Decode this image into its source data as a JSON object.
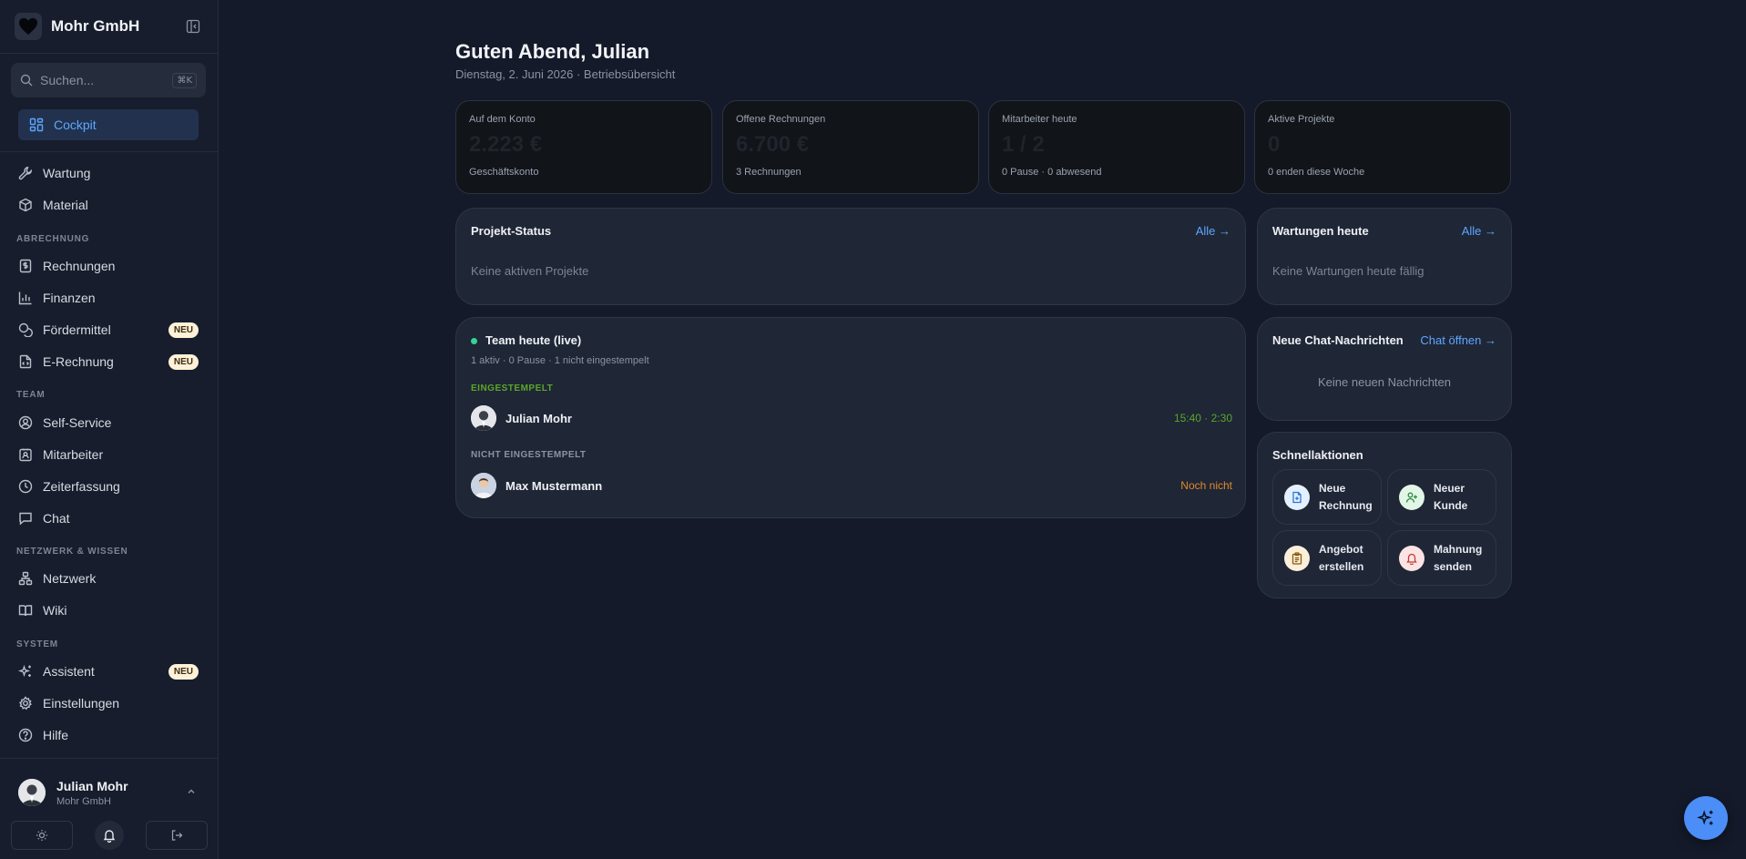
{
  "brand": {
    "name": "Mohr GmbH",
    "logo_icon": "heart-icon"
  },
  "search": {
    "placeholder": "Suchen...",
    "shortcut": "⌘K"
  },
  "sidebar": {
    "active": {
      "label": "Cockpit",
      "icon": "dashboard-icon"
    },
    "items": [
      {
        "label": "Wartung",
        "icon": "wrench-icon"
      },
      {
        "label": "Material",
        "icon": "box-icon"
      }
    ],
    "sections": [
      {
        "title": "ABRECHNUNG",
        "items": [
          {
            "label": "Rechnungen",
            "icon": "invoice-icon"
          },
          {
            "label": "Finanzen",
            "icon": "chart-icon"
          },
          {
            "label": "Fördermittel",
            "icon": "coins-icon",
            "badge": "NEU"
          },
          {
            "label": "E-Rechnung",
            "icon": "e-invoice-icon",
            "badge": "NEU"
          }
        ]
      },
      {
        "title": "TEAM",
        "items": [
          {
            "label": "Self-Service",
            "icon": "user-circle-icon"
          },
          {
            "label": "Mitarbeiter",
            "icon": "id-badge-icon"
          },
          {
            "label": "Zeiterfassung",
            "icon": "clock-icon"
          },
          {
            "label": "Chat",
            "icon": "chat-icon"
          }
        ]
      },
      {
        "title": "NETZWERK & WISSEN",
        "items": [
          {
            "label": "Netzwerk",
            "icon": "network-icon"
          },
          {
            "label": "Wiki",
            "icon": "book-icon"
          }
        ]
      },
      {
        "title": "SYSTEM",
        "items": [
          {
            "label": "Assistent",
            "icon": "sparkles-icon",
            "badge": "NEU"
          },
          {
            "label": "Einstellungen",
            "icon": "gear-icon"
          },
          {
            "label": "Hilfe",
            "icon": "help-icon"
          }
        ]
      }
    ]
  },
  "user": {
    "name": "Julian Mohr",
    "company": "Mohr GmbH"
  },
  "header": {
    "greeting": "Guten Abend, Julian",
    "subline": "Dienstag, 2. Juni 2026 · Betriebsübersicht"
  },
  "stats": [
    {
      "label": "Auf dem Konto",
      "value": "2.223 €",
      "sub": "Geschäftskonto"
    },
    {
      "label": "Offene Rechnungen",
      "value": "6.700 €",
      "sub": "3 Rechnungen"
    },
    {
      "label": "Mitarbeiter heute",
      "value": "1 / 2",
      "sub": "0 Pause · 0 abwesend"
    },
    {
      "label": "Aktive Projekte",
      "value": "0",
      "sub": "0 enden diese Woche"
    }
  ],
  "projects": {
    "title": "Projekt-Status",
    "link": "Alle →",
    "empty": "Keine aktiven Projekte"
  },
  "maintenance": {
    "title": "Wartungen heute",
    "link": "Alle →",
    "empty": "Keine Wartungen heute fällig"
  },
  "team": {
    "title": "Team heute (live)",
    "summary": "1 aktiv · 0 Pause · 1 nicht eingestempelt",
    "clocked_in_label": "EINGESTEMPELT",
    "not_clocked_label": "NICHT EINGESTEMPELT",
    "clocked_in": [
      {
        "name": "Julian Mohr",
        "status": "15:40 · 2:30"
      }
    ],
    "not_clocked": [
      {
        "name": "Max Mustermann",
        "status": "Noch nicht"
      }
    ]
  },
  "chat": {
    "title": "Neue Chat-Nachrichten",
    "link": "Chat öffnen →",
    "empty": "Keine neuen Nachrichten"
  },
  "quick_actions": {
    "title": "Schnellaktionen",
    "items": [
      {
        "label": "Neue Rechnung",
        "icon": "file-plus-icon"
      },
      {
        "label": "Neuer Kunde",
        "icon": "user-plus-icon"
      },
      {
        "label": "Angebot erstellen",
        "icon": "clipboard-icon"
      },
      {
        "label": "Mahnung senden",
        "icon": "bell-icon"
      }
    ]
  },
  "colors": {
    "accent": "#5ea6ff",
    "live": "#34d399",
    "clocked_in": "#5aa62a",
    "not_clocked": "#e08a2c",
    "badge_bg": "#fdf1d8"
  }
}
